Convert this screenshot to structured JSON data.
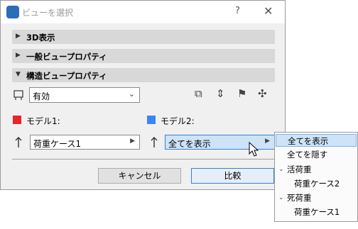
{
  "window": {
    "title": "ビューを選択",
    "help_glyph": "?",
    "close_glyph": "✕"
  },
  "sections": [
    {
      "label": "3D表示",
      "expanded": false
    },
    {
      "label": "一般ビュープロパティ",
      "expanded": false
    },
    {
      "label": "構造ビュープロパティ",
      "expanded": true
    }
  ],
  "filter_select": {
    "value": "有効"
  },
  "toolbar_icons": [
    "frame-3d-icon",
    "axis-move-icon",
    "flag-icon",
    "axes-icon"
  ],
  "model1": {
    "label": "モデル1:",
    "color": "#e8242b",
    "select_value": "荷重ケース1"
  },
  "model2": {
    "label": "モデル2:",
    "color": "#3a86f0",
    "select_value": "全てを表示"
  },
  "buttons": {
    "cancel": "キャンセル",
    "compare": "比較"
  },
  "popup": {
    "items": [
      {
        "label": "全てを表示",
        "selected": true,
        "indent": 0,
        "chevron": false
      },
      {
        "label": "全てを隠す",
        "selected": false,
        "indent": 0,
        "chevron": false
      },
      {
        "label": "活荷重",
        "selected": false,
        "indent": 0,
        "chevron": true
      },
      {
        "label": "荷重ケース2",
        "selected": false,
        "indent": 1,
        "chevron": false
      },
      {
        "label": "死荷重",
        "selected": false,
        "indent": 0,
        "chevron": true
      },
      {
        "label": "荷重ケース1",
        "selected": false,
        "indent": 1,
        "chevron": false
      }
    ]
  }
}
